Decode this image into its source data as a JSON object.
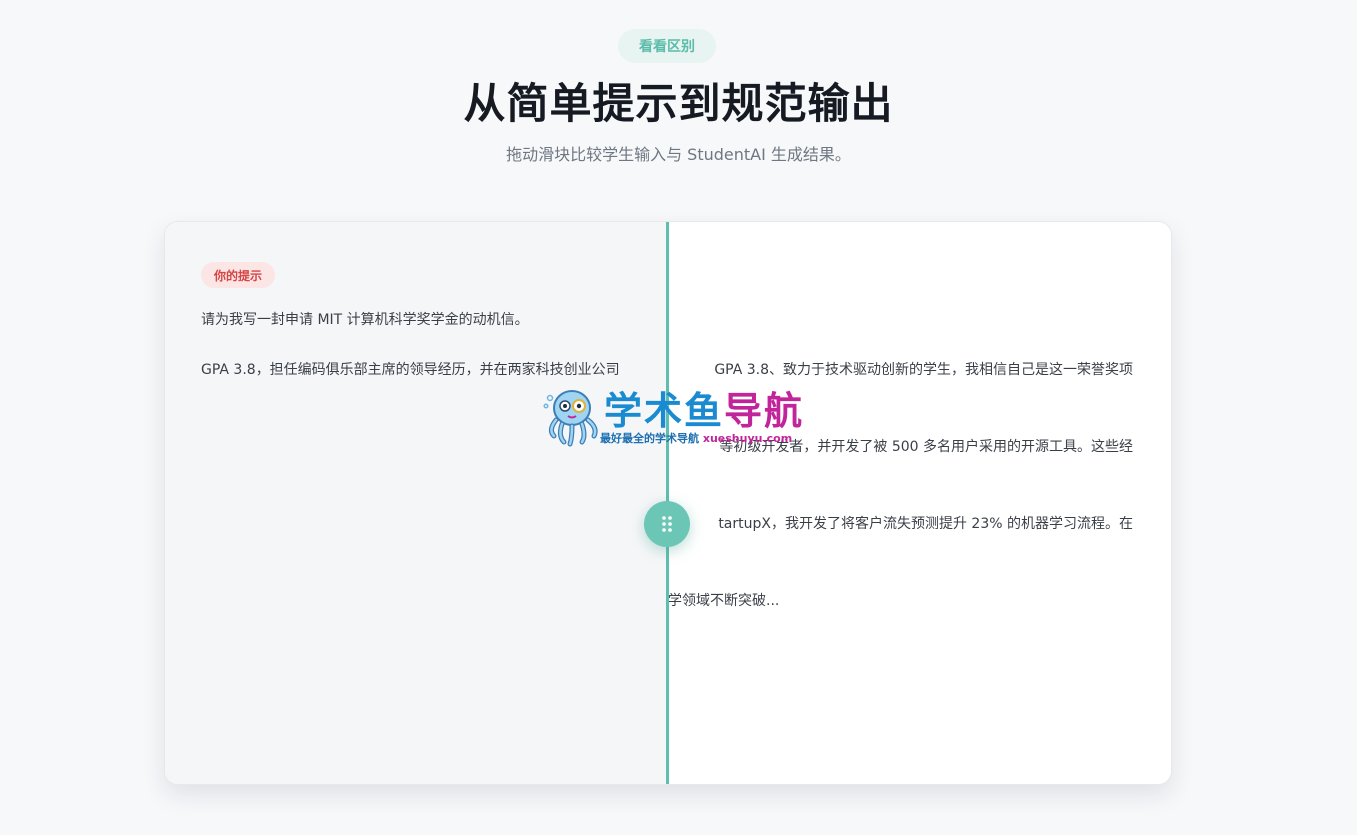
{
  "header": {
    "eyebrow": "看看区别",
    "title": "从简单提示到规范输出",
    "subtitle": "拖动滑块比较学生输入与 StudentAI 生成结果。"
  },
  "before": {
    "tag": "你的提示",
    "lines": [
      "请为我写一封申请 MIT 计算机科学奖学金的动机信。",
      "GPA 3.8，担任编码俱乐部主席的领导经历，并在两家科技创业公司"
    ]
  },
  "after": {
    "lines": [
      "GPA 3.8、致力于技术驱动创新的学生，我相信自己是这一荣誉奖项",
      "等初级开发者，并开发了被 500 多名用户采用的开源工具。这些经",
      "tartupX，我开发了将客户流失预测提升 23% 的机器学习流程。在",
      "学领域不断突破..."
    ]
  },
  "slider": {
    "handle_icon": "grip-dots-icon",
    "accent": "#5fbfae"
  },
  "watermark": {
    "title_part1": "学术鱼",
    "title_part2": "导航",
    "tagline": "最好最全的学术导航",
    "url": "xueshuyu.com"
  }
}
